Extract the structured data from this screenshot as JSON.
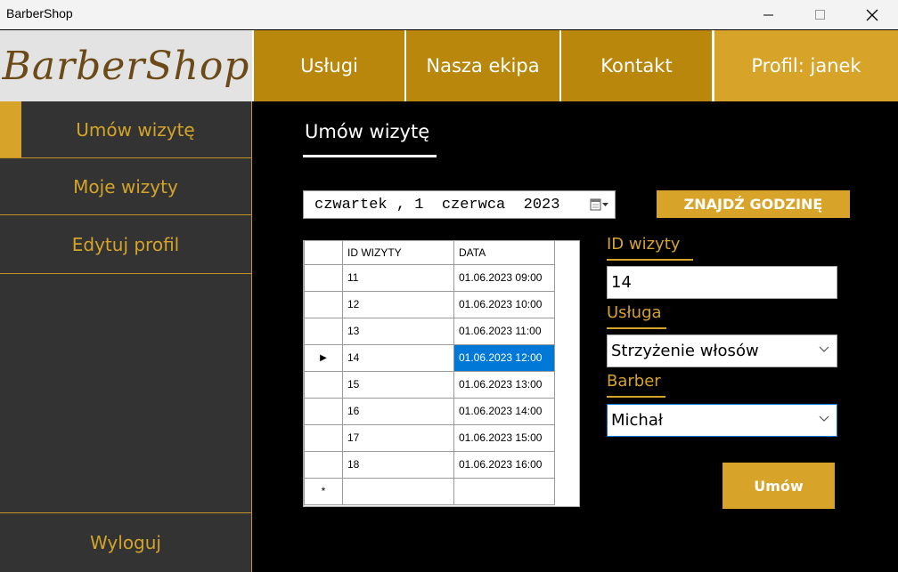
{
  "window": {
    "title": "BarberShop"
  },
  "logo": {
    "text": "BarberShop"
  },
  "nav": {
    "uslugi": "Usługi",
    "ekipa": "Nasza ekipa",
    "kontakt": "Kontakt",
    "profil": "Profil: janek"
  },
  "sidebar": {
    "items": [
      {
        "label": "Umów wizytę"
      },
      {
        "label": "Moje wizyty"
      },
      {
        "label": "Edytuj profil"
      }
    ],
    "logout": "Wyloguj"
  },
  "main": {
    "title": "Umów wizytę",
    "date": "czwartek , 1  czerwca  2023",
    "find_button": "ZNAJDŹ GODZINĘ"
  },
  "grid": {
    "headers": [
      "ID WIZYTY",
      "DATA"
    ],
    "rows": [
      [
        "11",
        "01.06.2023 09:00"
      ],
      [
        "12",
        "01.06.2023 10:00"
      ],
      [
        "13",
        "01.06.2023 11:00"
      ],
      [
        "14",
        "01.06.2023 12:00"
      ],
      [
        "15",
        "01.06.2023 13:00"
      ],
      [
        "16",
        "01.06.2023 14:00"
      ],
      [
        "17",
        "01.06.2023 15:00"
      ],
      [
        "18",
        "01.06.2023 16:00"
      ]
    ],
    "selected_row_marker": "▶",
    "new_row_marker": "*"
  },
  "form": {
    "id_label": "ID wizyty",
    "id_value": "14",
    "service_label": "Usługa",
    "service_value": "Strzyżenie włosów",
    "barber_label": "Barber",
    "barber_value": "Michał",
    "submit": "Umów"
  },
  "colors": {
    "accent_gold": "#d7a429",
    "nav_gold": "#b8870b",
    "sidebar_bg": "#333333",
    "selection_blue": "#0078d7"
  }
}
